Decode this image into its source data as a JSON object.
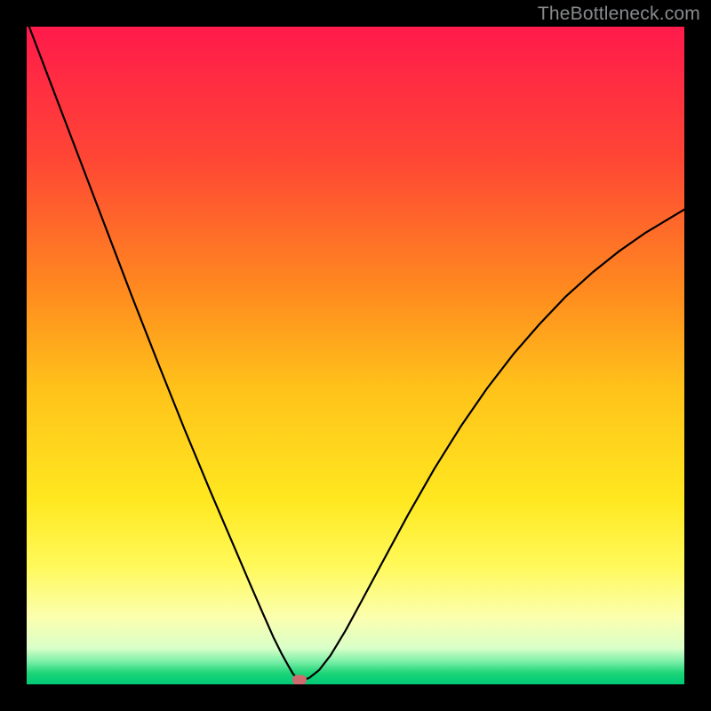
{
  "watermark": {
    "text": "TheBottleneck.com"
  },
  "chart_data": {
    "type": "line",
    "title": "",
    "xlabel": "",
    "ylabel": "",
    "xlim": [
      0,
      1
    ],
    "ylim": [
      0,
      1
    ],
    "background_gradient_stops": [
      {
        "offset": 0.0,
        "color": "#ff1a4b"
      },
      {
        "offset": 0.2,
        "color": "#ff4635"
      },
      {
        "offset": 0.4,
        "color": "#ff8a1f"
      },
      {
        "offset": 0.55,
        "color": "#ffc21a"
      },
      {
        "offset": 0.72,
        "color": "#ffe820"
      },
      {
        "offset": 0.82,
        "color": "#fff95a"
      },
      {
        "offset": 0.9,
        "color": "#fbffb0"
      },
      {
        "offset": 0.945,
        "color": "#d9ffc8"
      },
      {
        "offset": 0.965,
        "color": "#7df0a8"
      },
      {
        "offset": 0.983,
        "color": "#1cd477"
      },
      {
        "offset": 1.0,
        "color": "#00c977"
      }
    ],
    "series": [
      {
        "name": "bottleneck-curve",
        "color": "#000000",
        "stroke_width": 2.2,
        "x": [
          0.0,
          0.04,
          0.08,
          0.12,
          0.16,
          0.2,
          0.24,
          0.28,
          0.31,
          0.34,
          0.36,
          0.375,
          0.388,
          0.398,
          0.405,
          0.412,
          0.42,
          0.43,
          0.445,
          0.462,
          0.485,
          0.51,
          0.54,
          0.58,
          0.62,
          0.66,
          0.7,
          0.74,
          0.78,
          0.82,
          0.86,
          0.9,
          0.94,
          0.98,
          1.0
        ],
        "y": [
          1.01,
          0.905,
          0.8,
          0.695,
          0.59,
          0.488,
          0.388,
          0.292,
          0.222,
          0.152,
          0.106,
          0.072,
          0.046,
          0.028,
          0.016,
          0.008,
          0.006,
          0.01,
          0.022,
          0.044,
          0.082,
          0.128,
          0.184,
          0.258,
          0.328,
          0.392,
          0.45,
          0.502,
          0.548,
          0.59,
          0.626,
          0.658,
          0.686,
          0.71,
          0.722
        ]
      }
    ],
    "marker": {
      "x": 0.415,
      "y": 0.007,
      "color": "#cf6a6f"
    }
  }
}
